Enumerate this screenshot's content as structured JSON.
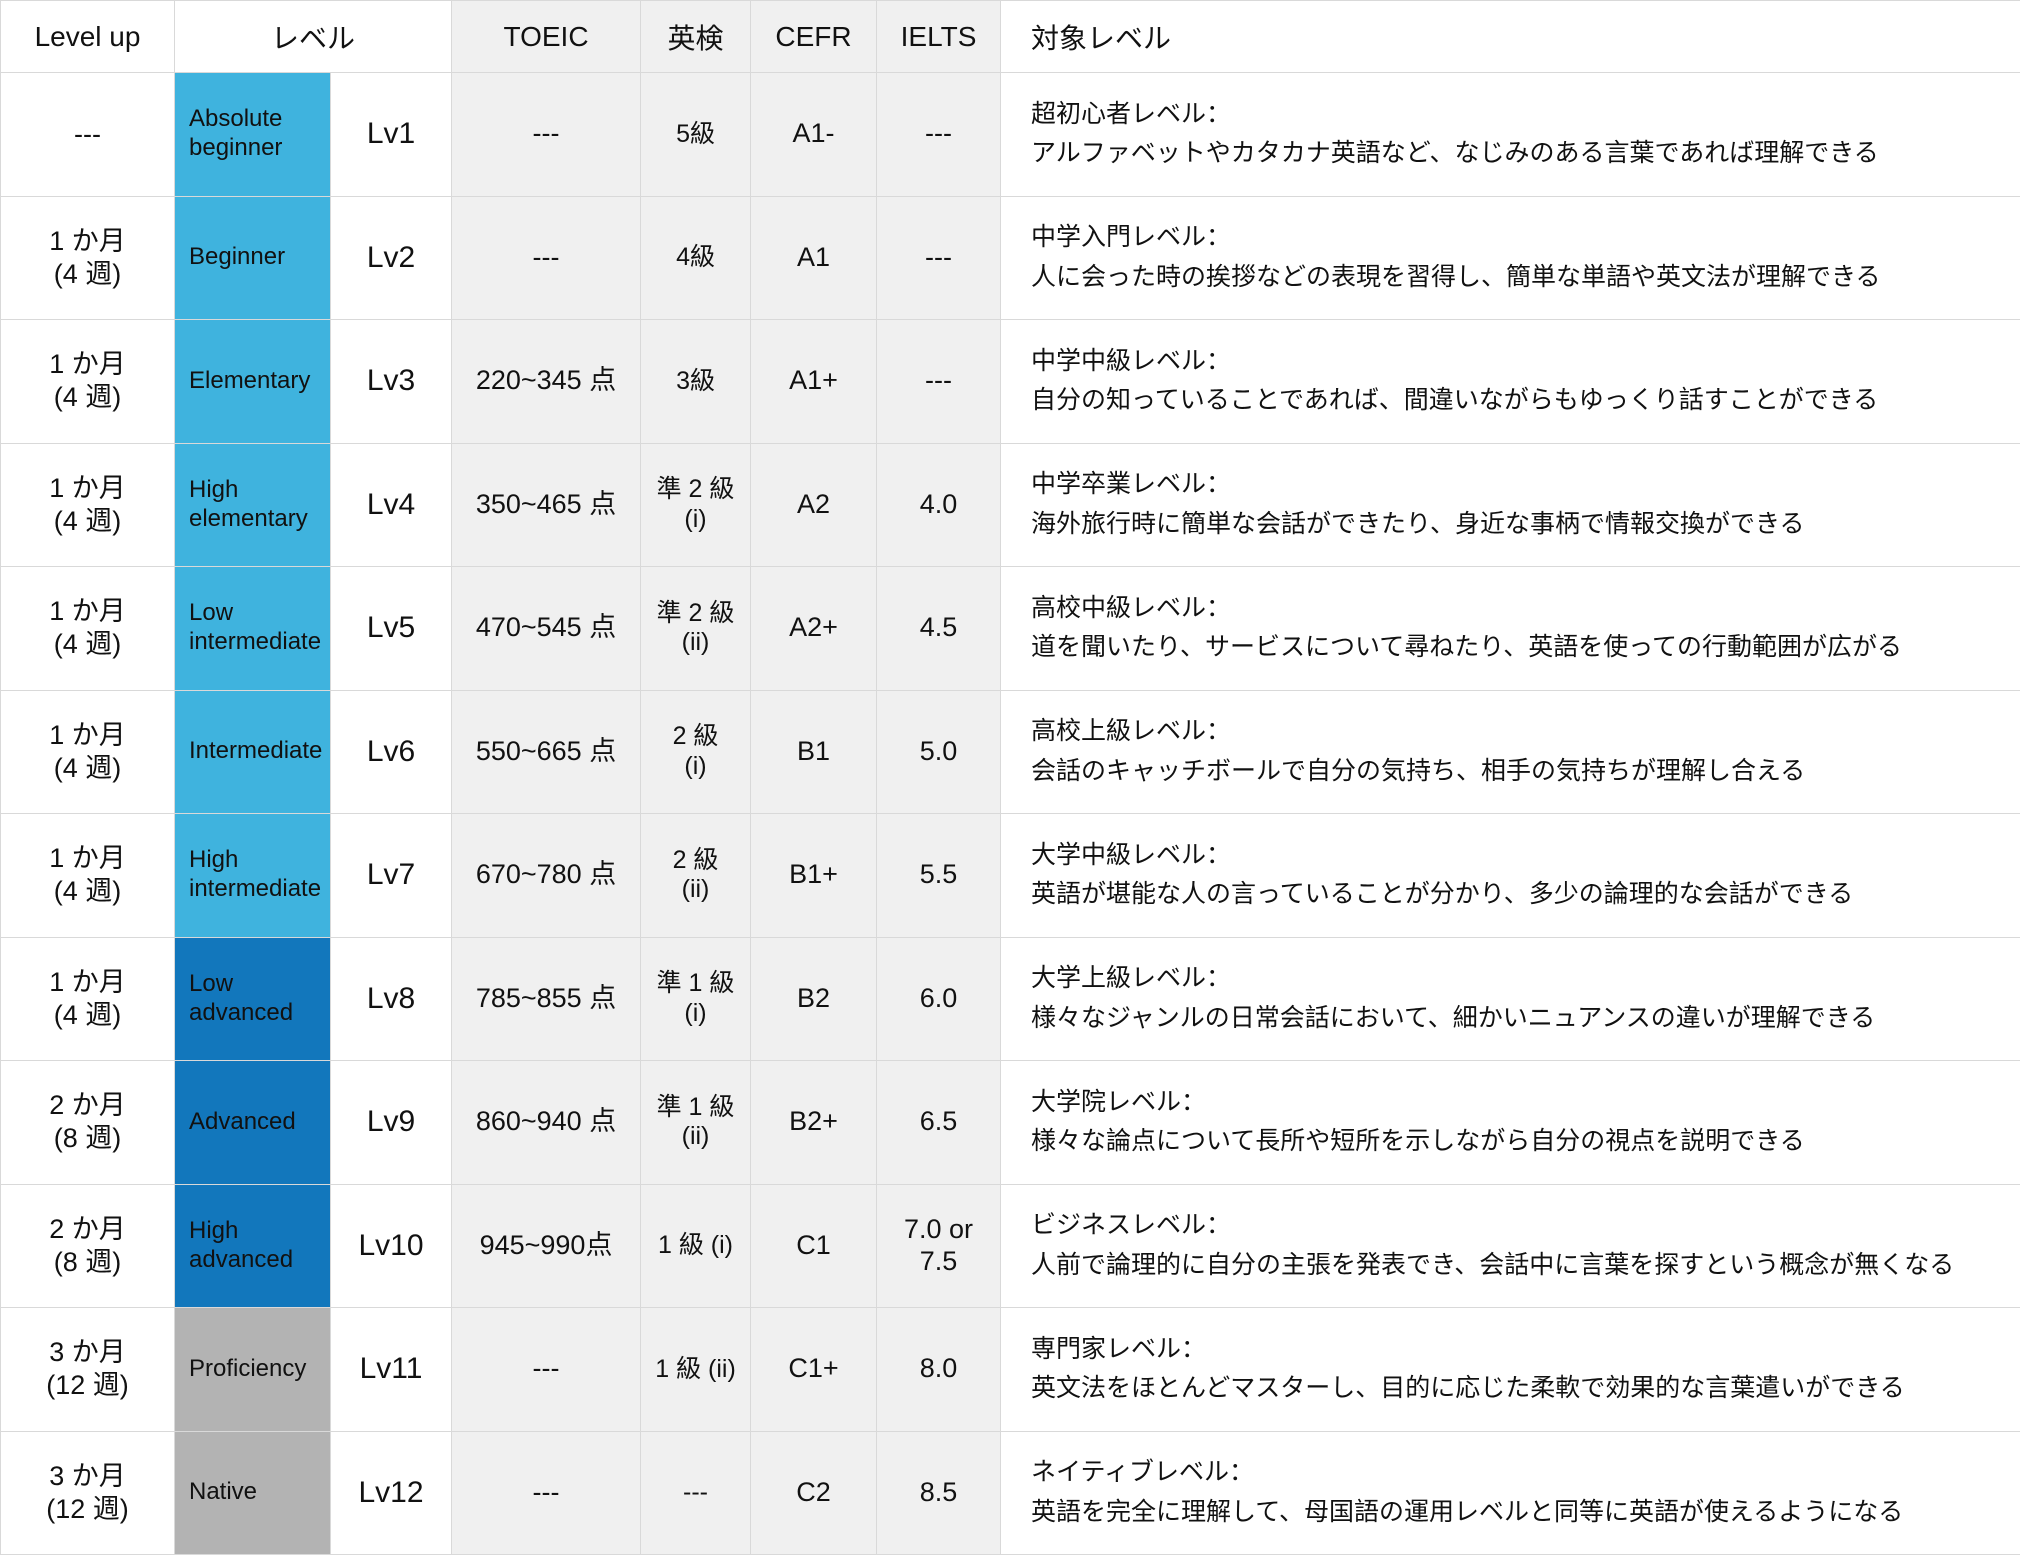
{
  "table": {
    "headers": {
      "levelup": "Level up",
      "band": "レベル",
      "lv": "",
      "toeic": "TOEIC",
      "eiken": "英検",
      "cefr": "CEFR",
      "ielts": "IELTS",
      "target": "対象レベル"
    },
    "colors": {
      "light_blue": "#3FB3DE",
      "dark_blue": "#1277BC",
      "gray": "#B3B3B3",
      "shaded_cell": "#F0F0F0",
      "grid_line": "#D9D9D9",
      "text": "#111111",
      "band_text": "#FFFFFF"
    },
    "rows": [
      {
        "levelup": "---",
        "band": "Absolute\nbeginner",
        "band_color": "#3FB3DE",
        "lv": "Lv1",
        "toeic": "---",
        "eiken": "5級",
        "cefr": "A1-",
        "ielts": "---",
        "target_title": "超初心者レベル：",
        "target_body": "アルファベットやカタカナ英語など、なじみのある言葉であれば理解できる"
      },
      {
        "levelup": "1 か月\n(4 週)",
        "band": "Beginner",
        "band_color": "#3FB3DE",
        "lv": "Lv2",
        "toeic": "---",
        "eiken": "4級",
        "cefr": "A1",
        "ielts": "---",
        "target_title": "中学入門レベル：",
        "target_body": "人に会った時の挨拶などの表現を習得し、簡単な単語や英文法が理解できる"
      },
      {
        "levelup": "1 か月\n(4 週)",
        "band": "Elementary",
        "band_color": "#3FB3DE",
        "lv": "Lv3",
        "toeic": "220~345 点",
        "eiken": "3級",
        "cefr": "A1+",
        "ielts": "---",
        "target_title": "中学中級レベル：",
        "target_body": "自分の知っていることであれば、間違いながらもゆっくり話すことができる"
      },
      {
        "levelup": "1 か月\n(4 週)",
        "band": "High\nelementary",
        "band_color": "#3FB3DE",
        "lv": "Lv4",
        "toeic": "350~465 点",
        "eiken": "準 2 級\n(i)",
        "cefr": "A2",
        "ielts": "4.0",
        "target_title": "中学卒業レベル：",
        "target_body": "海外旅行時に簡単な会話ができたり、身近な事柄で情報交換ができる"
      },
      {
        "levelup": "1 か月\n(4 週)",
        "band": "Low\nintermediate",
        "band_color": "#3FB3DE",
        "lv": "Lv5",
        "toeic": "470~545 点",
        "eiken": "準 2 級\n(ii)",
        "cefr": "A2+",
        "ielts": "4.5",
        "target_title": "高校中級レベル：",
        "target_body": "道を聞いたり、サービスについて尋ねたり、英語を使っての行動範囲が広がる"
      },
      {
        "levelup": "1 か月\n(4 週)",
        "band": "Intermediate",
        "band_color": "#3FB3DE",
        "lv": "Lv6",
        "toeic": "550~665 点",
        "eiken": "2 級\n(i)",
        "cefr": "B1",
        "ielts": "5.0",
        "target_title": "高校上級レベル：",
        "target_body": "会話のキャッチボールで自分の気持ち、相手の気持ちが理解し合える"
      },
      {
        "levelup": "1 か月\n(4 週)",
        "band": "High\nintermediate",
        "band_color": "#3FB3DE",
        "lv": "Lv7",
        "toeic": "670~780 点",
        "eiken": "2 級\n(ii)",
        "cefr": "B1+",
        "ielts": "5.5",
        "target_title": "大学中級レベル：",
        "target_body": "英語が堪能な人の言っていることが分かり、多少の論理的な会話ができる"
      },
      {
        "levelup": "1 か月\n(4 週)",
        "band": "Low\nadvanced",
        "band_color": "#1277BC",
        "lv": "Lv8",
        "toeic": "785~855 点",
        "eiken": "準 1 級\n(i)",
        "cefr": "B2",
        "ielts": "6.0",
        "target_title": "大学上級レベル：",
        "target_body": "様々なジャンルの日常会話において、細かいニュアンスの違いが理解できる"
      },
      {
        "levelup": "2 か月\n(8 週)",
        "band": "Advanced",
        "band_color": "#1277BC",
        "lv": "Lv9",
        "toeic": "860~940 点",
        "eiken": "準 1 級\n(ii)",
        "cefr": "B2+",
        "ielts": "6.5",
        "target_title": "大学院レベル：",
        "target_body": "様々な論点について長所や短所を示しながら自分の視点を説明できる"
      },
      {
        "levelup": "2 か月\n(8 週)",
        "band": "High\nadvanced",
        "band_color": "#1277BC",
        "lv": "Lv10",
        "toeic": "945~990点",
        "eiken": "1 級 (i)",
        "cefr": "C1",
        "ielts": "7.0 or\n7.5",
        "target_title": "ビジネスレベル：",
        "target_body": "人前で論理的に自分の主張を発表でき、会話中に言葉を探すという概念が無くなる"
      },
      {
        "levelup": "3 か月\n(12 週)",
        "band": "Proficiency",
        "band_color": "#B3B3B3",
        "lv": "Lv11",
        "toeic": "---",
        "eiken": "1 級 (ii)",
        "cefr": "C1+",
        "ielts": "8.0",
        "target_title": "専門家レベル：",
        "target_body": "英文法をほとんどマスターし、目的に応じた柔軟で効果的な言葉遣いができる"
      },
      {
        "levelup": "3 か月\n(12 週)",
        "band": "Native",
        "band_color": "#B3B3B3",
        "lv": "Lv12",
        "toeic": "---",
        "eiken": "---",
        "cefr": "C2",
        "ielts": "8.5",
        "target_title": "ネイティブレベル：",
        "target_body": "英語を完全に理解して、母国語の運用レベルと同等に英語が使えるようになる"
      }
    ]
  }
}
